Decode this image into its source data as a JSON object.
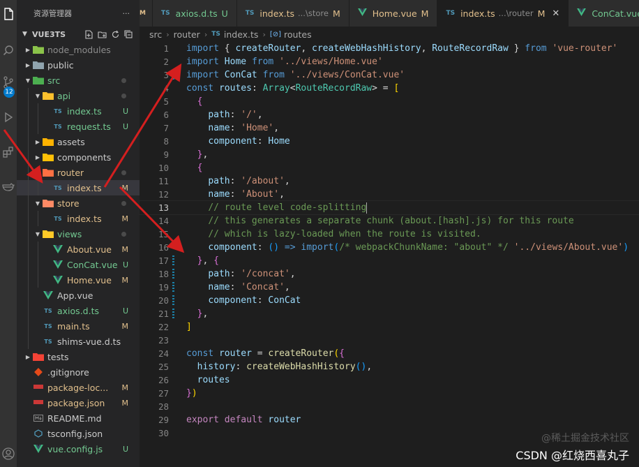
{
  "sidebar": {
    "title": "资源管理器",
    "more": "···",
    "project": "VUE3TS",
    "badge": "12",
    "items": [
      {
        "label": "node_modules",
        "depth": 1,
        "kind": "folder",
        "expanded": false,
        "icon": "node-folder-icon",
        "status": "",
        "dot": false,
        "dim": true
      },
      {
        "label": "public",
        "depth": 1,
        "kind": "folder",
        "expanded": false,
        "icon": "folder-icon",
        "status": "",
        "dot": false
      },
      {
        "label": "src",
        "depth": 1,
        "kind": "folder",
        "expanded": true,
        "icon": "src-folder-icon",
        "status": "",
        "dot": true,
        "color": "unt"
      },
      {
        "label": "api",
        "depth": 2,
        "kind": "folder",
        "expanded": true,
        "icon": "api-folder-icon",
        "status": "",
        "dot": true,
        "color": "unt"
      },
      {
        "label": "index.ts",
        "depth": 3,
        "kind": "ts",
        "icon": "typescript-icon",
        "status": "U",
        "color": "unt"
      },
      {
        "label": "request.ts",
        "depth": 3,
        "kind": "ts",
        "icon": "typescript-icon",
        "status": "U",
        "color": "unt"
      },
      {
        "label": "assets",
        "depth": 2,
        "kind": "folder",
        "expanded": false,
        "icon": "assets-folder-icon",
        "status": ""
      },
      {
        "label": "components",
        "depth": 2,
        "kind": "folder",
        "expanded": false,
        "icon": "components-folder-icon",
        "status": ""
      },
      {
        "label": "router",
        "depth": 2,
        "kind": "folder",
        "expanded": true,
        "icon": "router-folder-icon",
        "status": "",
        "dot": true,
        "color": "mod"
      },
      {
        "label": "index.ts",
        "depth": 3,
        "kind": "ts",
        "icon": "typescript-icon",
        "status": "M",
        "color": "mod",
        "selected": true
      },
      {
        "label": "store",
        "depth": 2,
        "kind": "folder",
        "expanded": true,
        "icon": "store-folder-icon",
        "status": "",
        "dot": true,
        "color": "mod"
      },
      {
        "label": "index.ts",
        "depth": 3,
        "kind": "ts",
        "icon": "typescript-icon",
        "status": "M",
        "color": "mod"
      },
      {
        "label": "views",
        "depth": 2,
        "kind": "folder",
        "expanded": true,
        "icon": "views-folder-icon",
        "status": "",
        "dot": true,
        "color": "unt"
      },
      {
        "label": "About.vue",
        "depth": 3,
        "kind": "vue",
        "icon": "vue-icon",
        "status": "M",
        "color": "mod"
      },
      {
        "label": "ConCat.vue",
        "depth": 3,
        "kind": "vue",
        "icon": "vue-icon",
        "status": "U",
        "color": "unt"
      },
      {
        "label": "Home.vue",
        "depth": 3,
        "kind": "vue",
        "icon": "vue-icon",
        "status": "M",
        "color": "mod"
      },
      {
        "label": "App.vue",
        "depth": 2,
        "kind": "vue",
        "icon": "vue-icon",
        "status": ""
      },
      {
        "label": "axios.d.ts",
        "depth": 2,
        "kind": "ts",
        "icon": "typescript-icon",
        "status": "U",
        "color": "unt"
      },
      {
        "label": "main.ts",
        "depth": 2,
        "kind": "ts",
        "icon": "typescript-icon",
        "status": "M",
        "color": "mod"
      },
      {
        "label": "shims-vue.d.ts",
        "depth": 2,
        "kind": "ts",
        "icon": "typescript-icon",
        "status": ""
      },
      {
        "label": "tests",
        "depth": 1,
        "kind": "folder",
        "expanded": false,
        "icon": "tests-folder-icon",
        "status": ""
      },
      {
        "label": ".gitignore",
        "depth": 1,
        "kind": "file",
        "icon": "git-icon",
        "status": ""
      },
      {
        "label": "package-loc...",
        "depth": 1,
        "kind": "file",
        "icon": "npm-icon",
        "status": "M",
        "color": "mod"
      },
      {
        "label": "package.json",
        "depth": 1,
        "kind": "file",
        "icon": "npm-icon",
        "status": "M",
        "color": "mod"
      },
      {
        "label": "README.md",
        "depth": 1,
        "kind": "file",
        "icon": "markdown-icon",
        "status": ""
      },
      {
        "label": "tsconfig.json",
        "depth": 1,
        "kind": "file",
        "icon": "tsconfig-icon",
        "status": ""
      },
      {
        "label": "vue.config.js",
        "depth": 1,
        "kind": "vue",
        "icon": "vue-icon",
        "status": "U",
        "color": "unt"
      }
    ]
  },
  "tabs": [
    {
      "icon": "M",
      "label": "",
      "desc": "",
      "status": "",
      "partial": true
    },
    {
      "icon": "TS",
      "label": "axios.d.ts",
      "desc": "",
      "status": "U",
      "color": "unt"
    },
    {
      "icon": "TS",
      "label": "index.ts",
      "desc": "...\\store",
      "status": "M",
      "color": "mod"
    },
    {
      "icon": "V",
      "label": "Home.vue",
      "desc": "",
      "status": "M",
      "color": "mod"
    },
    {
      "icon": "TS",
      "label": "index.ts",
      "desc": "...\\router",
      "status": "M",
      "color": "mod",
      "active": true
    },
    {
      "icon": "V",
      "label": "ConCat.vue",
      "desc": "",
      "status": "",
      "color": "unt"
    }
  ],
  "breadcrumb": [
    "src",
    "router",
    "index.ts",
    "routes"
  ],
  "editor": {
    "current_line": 13,
    "lines": [
      {
        "n": "1",
        "t": [
          [
            "kw",
            "import"
          ],
          [
            "pl",
            " { "
          ],
          [
            "var",
            "createRouter"
          ],
          [
            "pl",
            ", "
          ],
          [
            "var",
            "createWebHashHistory"
          ],
          [
            "pl",
            ", "
          ],
          [
            "var",
            "RouteRecordRaw"
          ],
          [
            "pl",
            " } "
          ],
          [
            "kw",
            "from"
          ],
          [
            "pl",
            " "
          ],
          [
            "str",
            "'vue-router'"
          ]
        ]
      },
      {
        "n": "2",
        "t": [
          [
            "kw",
            "import"
          ],
          [
            "pl",
            " "
          ],
          [
            "var",
            "Home"
          ],
          [
            "pl",
            " "
          ],
          [
            "kw",
            "from"
          ],
          [
            "pl",
            " "
          ],
          [
            "str",
            "'../views/Home.vue'"
          ]
        ]
      },
      {
        "n": "3",
        "t": [
          [
            "kw",
            "import"
          ],
          [
            "pl",
            " "
          ],
          [
            "var",
            "ConCat"
          ],
          [
            "pl",
            " "
          ],
          [
            "kw",
            "from"
          ],
          [
            "pl",
            " "
          ],
          [
            "str",
            "'../views/ConCat.vue'"
          ]
        ],
        "gutter": true
      },
      {
        "n": "4",
        "t": [
          [
            "kw",
            "const"
          ],
          [
            "pl",
            " "
          ],
          [
            "var",
            "routes"
          ],
          [
            "pl",
            ": "
          ],
          [
            "ty",
            "Array"
          ],
          [
            "pl",
            "<"
          ],
          [
            "ty",
            "RouteRecordRaw"
          ],
          [
            "pl",
            "> = "
          ],
          [
            "b1",
            "["
          ]
        ]
      },
      {
        "n": "5",
        "t": [
          [
            "pl",
            "  "
          ],
          [
            "b2",
            "{"
          ]
        ]
      },
      {
        "n": "6",
        "t": [
          [
            "pl",
            "    "
          ],
          [
            "var",
            "path"
          ],
          [
            "pl",
            ": "
          ],
          [
            "str",
            "'/'"
          ],
          [
            "pl",
            ","
          ]
        ]
      },
      {
        "n": "7",
        "t": [
          [
            "pl",
            "    "
          ],
          [
            "var",
            "name"
          ],
          [
            "pl",
            ": "
          ],
          [
            "str",
            "'Home'"
          ],
          [
            "pl",
            ","
          ]
        ]
      },
      {
        "n": "8",
        "t": [
          [
            "pl",
            "    "
          ],
          [
            "var",
            "component"
          ],
          [
            "pl",
            ": "
          ],
          [
            "var",
            "Home"
          ]
        ]
      },
      {
        "n": "9",
        "t": [
          [
            "pl",
            "  "
          ],
          [
            "b2",
            "}"
          ],
          [
            "pl",
            ","
          ]
        ]
      },
      {
        "n": "10",
        "t": [
          [
            "pl",
            "  "
          ],
          [
            "b2",
            "{"
          ]
        ]
      },
      {
        "n": "11",
        "t": [
          [
            "pl",
            "    "
          ],
          [
            "var",
            "path"
          ],
          [
            "pl",
            ": "
          ],
          [
            "str",
            "'/about'"
          ],
          [
            "pl",
            ","
          ]
        ]
      },
      {
        "n": "12",
        "t": [
          [
            "pl",
            "    "
          ],
          [
            "var",
            "name"
          ],
          [
            "pl",
            ": "
          ],
          [
            "str",
            "'About'"
          ],
          [
            "pl",
            ","
          ]
        ]
      },
      {
        "n": "13",
        "t": [
          [
            "pl",
            "    "
          ],
          [
            "cm",
            "// route level code-splitting"
          ],
          [
            "cursor",
            ""
          ]
        ]
      },
      {
        "n": "14",
        "t": [
          [
            "pl",
            "    "
          ],
          [
            "cm",
            "// this generates a separate chunk (about.[hash].js) for this route"
          ]
        ]
      },
      {
        "n": "15",
        "t": [
          [
            "pl",
            "    "
          ],
          [
            "cm",
            "// which is lazy-loaded when the route is visited."
          ]
        ]
      },
      {
        "n": "16",
        "t": [
          [
            "pl",
            "    "
          ],
          [
            "var",
            "component"
          ],
          [
            "pl",
            ": "
          ],
          [
            "b3",
            "()"
          ],
          [
            "pl",
            " "
          ],
          [
            "kw",
            "=>"
          ],
          [
            "pl",
            " "
          ],
          [
            "kw",
            "import"
          ],
          [
            "b3",
            "("
          ],
          [
            "cm",
            "/* webpackChunkName: \"about\" */"
          ],
          [
            "pl",
            " "
          ],
          [
            "str",
            "'../views/About.vue'"
          ],
          [
            "b3",
            ")"
          ]
        ]
      },
      {
        "n": "17",
        "t": [
          [
            "pl",
            "  "
          ],
          [
            "b2",
            "}"
          ],
          [
            "pl",
            ", "
          ],
          [
            "b2",
            "{"
          ]
        ],
        "gutter": true
      },
      {
        "n": "18",
        "t": [
          [
            "pl",
            "    "
          ],
          [
            "var",
            "path"
          ],
          [
            "pl",
            ": "
          ],
          [
            "str",
            "'/concat'"
          ],
          [
            "pl",
            ","
          ]
        ],
        "gutter": true
      },
      {
        "n": "19",
        "t": [
          [
            "pl",
            "    "
          ],
          [
            "var",
            "name"
          ],
          [
            "pl",
            ": "
          ],
          [
            "str",
            "'Concat'"
          ],
          [
            "pl",
            ","
          ]
        ],
        "gutter": true
      },
      {
        "n": "20",
        "t": [
          [
            "pl",
            "    "
          ],
          [
            "var",
            "component"
          ],
          [
            "pl",
            ": "
          ],
          [
            "var",
            "ConCat"
          ]
        ],
        "gutter": true
      },
      {
        "n": "21",
        "t": [
          [
            "pl",
            "  "
          ],
          [
            "b2",
            "}"
          ],
          [
            "pl",
            ","
          ]
        ],
        "gutter": true
      },
      {
        "n": "22",
        "t": [
          [
            "b1",
            "]"
          ]
        ]
      },
      {
        "n": "23",
        "t": []
      },
      {
        "n": "24",
        "t": [
          [
            "kw",
            "const"
          ],
          [
            "pl",
            " "
          ],
          [
            "var",
            "router"
          ],
          [
            "pl",
            " = "
          ],
          [
            "fn",
            "createRouter"
          ],
          [
            "b1",
            "("
          ],
          [
            "b2",
            "{"
          ]
        ]
      },
      {
        "n": "25",
        "t": [
          [
            "pl",
            "  "
          ],
          [
            "var",
            "history"
          ],
          [
            "pl",
            ": "
          ],
          [
            "fn",
            "createWebHashHistory"
          ],
          [
            "b3",
            "()"
          ],
          [
            "pl",
            ","
          ]
        ]
      },
      {
        "n": "26",
        "t": [
          [
            "pl",
            "  "
          ],
          [
            "var",
            "routes"
          ]
        ]
      },
      {
        "n": "27",
        "t": [
          [
            "b2",
            "}"
          ],
          [
            "b1",
            ")"
          ]
        ]
      },
      {
        "n": "28",
        "t": []
      },
      {
        "n": "29",
        "t": [
          [
            "ctl",
            "export"
          ],
          [
            "pl",
            " "
          ],
          [
            "ctl",
            "default"
          ],
          [
            "pl",
            " "
          ],
          [
            "var",
            "router"
          ]
        ]
      },
      {
        "n": "30",
        "t": []
      }
    ]
  },
  "watermark": {
    "line1": "@稀土掘金技术社区",
    "line2": "CSDN @红烧西喜丸子"
  },
  "colors": {
    "annotation_arrow": "#d41f1f",
    "accent": "#007acc",
    "modified": "#e2c08d",
    "untracked": "#73c991"
  }
}
